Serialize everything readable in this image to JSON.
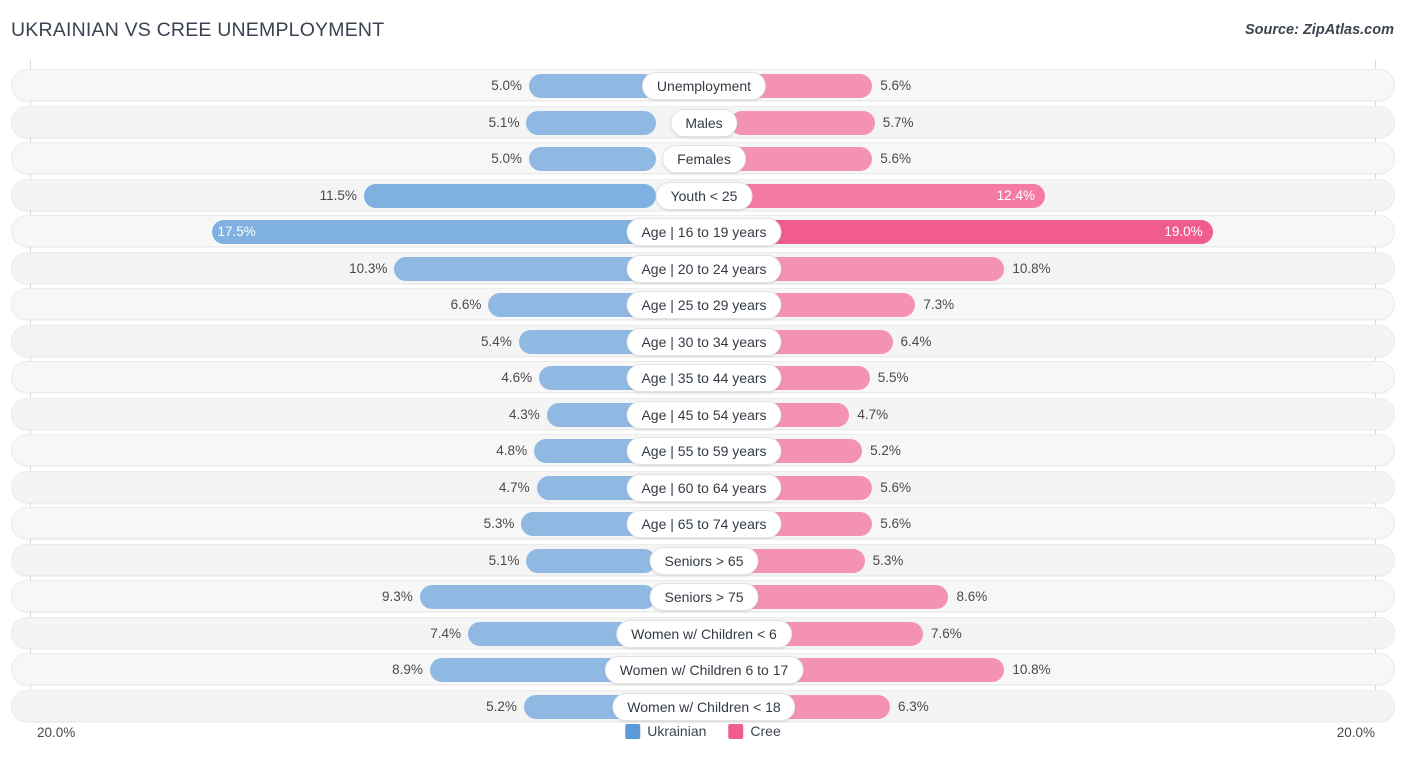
{
  "header": {
    "title": "UKRAINIAN VS CREE UNEMPLOYMENT",
    "source": "Source: ZipAtlas.com"
  },
  "axis": {
    "left_label": "20.0%",
    "right_label": "20.0%"
  },
  "legend": {
    "items": [
      {
        "label": "Ukrainian",
        "color": "#5b9bd8"
      },
      {
        "label": "Cree",
        "color": "#f05c8f"
      }
    ]
  },
  "chart_data": {
    "type": "bar",
    "orientation": "diverging-horizontal",
    "title": "UKRAINIAN VS CREE UNEMPLOYMENT",
    "xlabel": "",
    "ylabel": "",
    "xlim": [
      20.0,
      20.0
    ],
    "axis_max": 20.0,
    "unit": "%",
    "grid": true,
    "legend_position": "bottom-center",
    "categories": [
      "Unemployment",
      "Males",
      "Females",
      "Youth < 25",
      "Age | 16 to 19 years",
      "Age | 20 to 24 years",
      "Age | 25 to 29 years",
      "Age | 30 to 34 years",
      "Age | 35 to 44 years",
      "Age | 45 to 54 years",
      "Age | 55 to 59 years",
      "Age | 60 to 64 years",
      "Age | 65 to 74 years",
      "Seniors > 65",
      "Seniors > 75",
      "Women w/ Children < 6",
      "Women w/ Children 6 to 17",
      "Women w/ Children < 18"
    ],
    "series": [
      {
        "name": "Ukrainian",
        "side": "left",
        "color": "#8fb9e3",
        "values": [
          5.0,
          5.1,
          5.0,
          11.5,
          17.5,
          10.3,
          6.6,
          5.4,
          4.6,
          4.3,
          4.8,
          4.7,
          5.3,
          5.1,
          9.3,
          7.4,
          8.9,
          5.2
        ],
        "labels": [
          "5.0%",
          "5.1%",
          "5.0%",
          "11.5%",
          "17.5%",
          "10.3%",
          "6.6%",
          "5.4%",
          "4.6%",
          "4.3%",
          "4.8%",
          "4.7%",
          "5.3%",
          "5.1%",
          "9.3%",
          "7.4%",
          "8.9%",
          "5.2%"
        ]
      },
      {
        "name": "Cree",
        "side": "right",
        "color": "#f492b4",
        "values": [
          5.6,
          5.7,
          5.6,
          12.4,
          19.0,
          10.8,
          7.3,
          6.4,
          5.5,
          4.7,
          5.2,
          5.6,
          5.6,
          5.3,
          8.6,
          7.6,
          10.8,
          6.3
        ],
        "labels": [
          "5.6%",
          "5.7%",
          "5.6%",
          "12.4%",
          "19.0%",
          "10.8%",
          "7.3%",
          "6.4%",
          "5.5%",
          "4.7%",
          "5.2%",
          "5.6%",
          "5.6%",
          "5.3%",
          "8.6%",
          "7.6%",
          "10.8%",
          "6.3%"
        ]
      }
    ],
    "label_inside_rows": [
      {
        "row": 3,
        "side": "right"
      },
      {
        "row": 4,
        "side": "left"
      },
      {
        "row": 4,
        "side": "right"
      }
    ]
  }
}
